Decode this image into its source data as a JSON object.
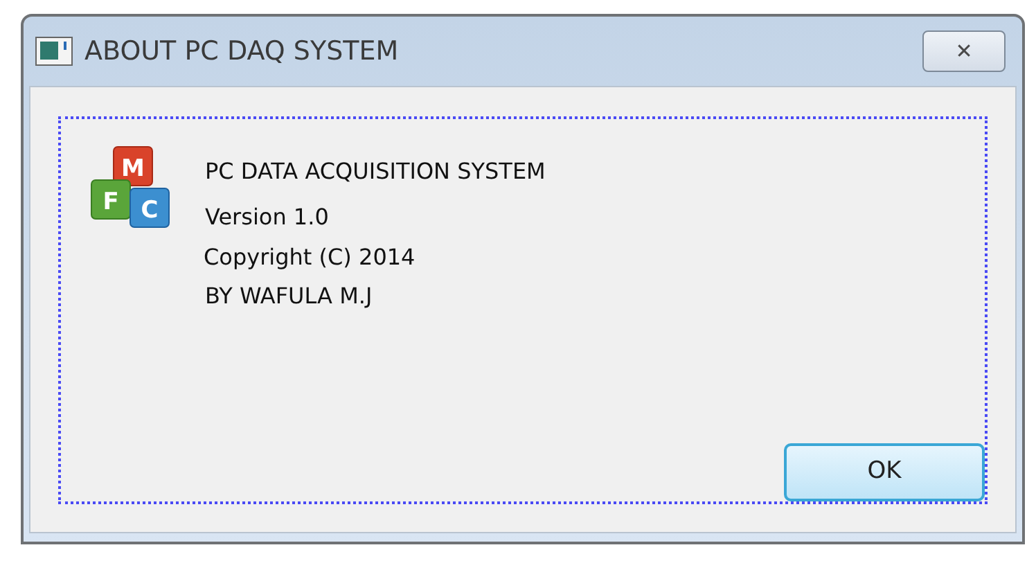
{
  "window": {
    "title": "ABOUT PC DAQ SYSTEM"
  },
  "logo": {
    "letters": [
      "M",
      "F",
      "C"
    ]
  },
  "lines": [
    "PC DATA ACQUISITION SYSTEM",
    "Version 1.0",
    "Copyright (C) 2014",
    "BY WAFULA M.J"
  ],
  "buttons": [
    {
      "label": "OK",
      "focused": true
    }
  ],
  "close_button": {
    "label": "✕"
  }
}
